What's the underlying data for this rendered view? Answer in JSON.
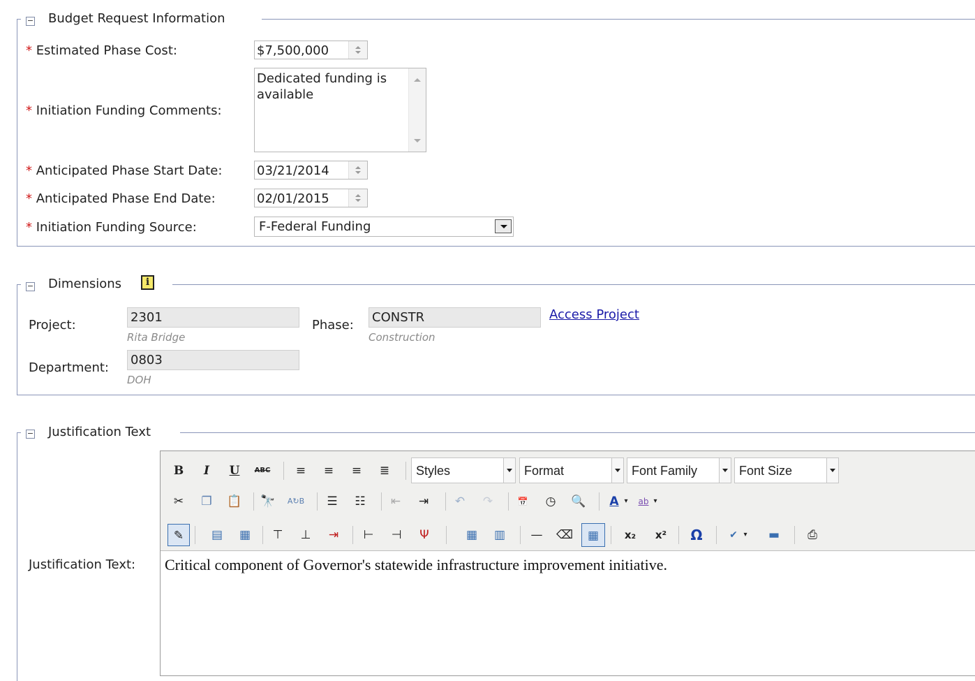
{
  "budget": {
    "legend": "Budget Request Information",
    "toggle": "−",
    "fields": {
      "estimated_cost_label": "Estimated Phase Cost:",
      "estimated_cost_value": "$7,500,000",
      "funding_comments_label": "Initiation Funding Comments:",
      "funding_comments_value": "Dedicated funding is available",
      "start_date_label": "Anticipated Phase Start Date:",
      "start_date_value": "03/21/2014",
      "end_date_label": "Anticipated Phase End Date:",
      "end_date_value": "02/01/2015",
      "funding_source_label": "Initiation Funding Source:",
      "funding_source_value": "F-Federal Funding"
    },
    "required_mark": "*"
  },
  "dimensions": {
    "legend": "Dimensions",
    "toggle": "−",
    "info_icon": "i",
    "project_label": "Project:",
    "project_value": "2301",
    "project_sub": "Rita Bridge",
    "phase_label": "Phase:",
    "phase_value": "CONSTR",
    "phase_sub": "Construction",
    "access_link": "Access Project",
    "department_label": "Department:",
    "department_value": "0803",
    "department_sub": "DOH"
  },
  "justification": {
    "legend": "Justification Text",
    "toggle": "−",
    "label": "Justification Text:",
    "content": "Critical component of Governor's statewide infrastructure improvement initiative.",
    "toolbar": {
      "styles": "Styles",
      "format": "Format",
      "font_family": "Font Family",
      "font_size": "Font Size",
      "bold": "B",
      "italic": "I",
      "underline": "U",
      "strike": "ABC",
      "omega": "Ω"
    }
  },
  "colors": {
    "fieldset_border": "#8a95b8",
    "required": "#d01a1a",
    "link": "#1a1aa8",
    "readonly_bg": "#e9e9e9"
  }
}
